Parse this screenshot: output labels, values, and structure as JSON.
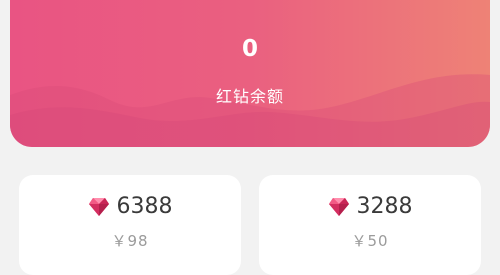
{
  "balance": {
    "amount": "0",
    "label": "红钻余额"
  },
  "packages": [
    {
      "amount": "6388",
      "price": "￥98",
      "icon": "red-diamond-icon"
    },
    {
      "amount": "3288",
      "price": "￥50",
      "icon": "red-diamond-icon"
    }
  ],
  "colors": {
    "gradient_start": "#e95483",
    "gradient_end": "#ee8276",
    "page_background": "#f2f2f2",
    "card_background": "#ffffff",
    "amount_text": "#3a3a3a",
    "price_text": "#9b9b9b"
  }
}
